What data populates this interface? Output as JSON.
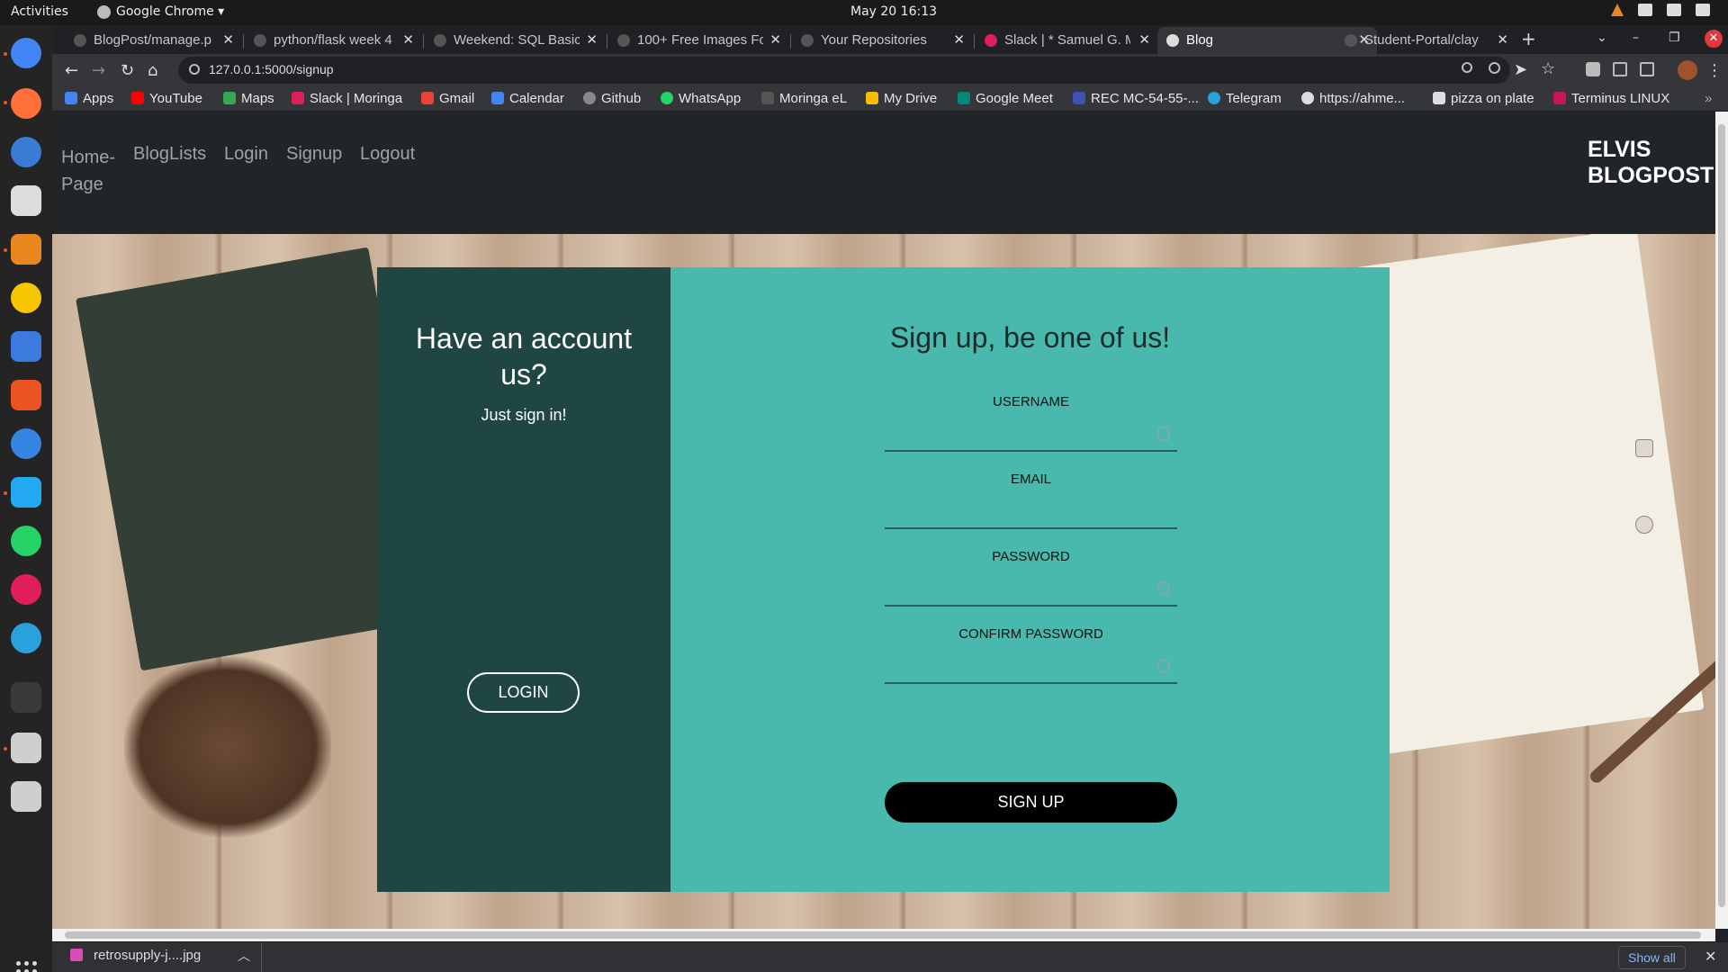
{
  "system": {
    "activities": "Activities",
    "app_name": "Google Chrome ▾",
    "clock": "May 20  16:13"
  },
  "tabs": [
    {
      "title": "BlogPost/manage.p",
      "active": false
    },
    {
      "title": "python/flask week 4",
      "active": false
    },
    {
      "title": "Weekend: SQL Basic",
      "active": false
    },
    {
      "title": "100+ Free Images Fo",
      "active": false
    },
    {
      "title": "Your Repositories",
      "active": false
    },
    {
      "title": "Slack | * Samuel G. M",
      "active": false
    },
    {
      "title": "Blog",
      "active": true
    },
    {
      "title": "Student-Portal/clay",
      "active": false
    }
  ],
  "address_bar": {
    "url": "127.0.0.1:5000/signup"
  },
  "bookmarks": [
    {
      "label": "Apps",
      "color": "#4285f4"
    },
    {
      "label": "YouTube",
      "color": "#ff0000"
    },
    {
      "label": "Maps",
      "color": "#34a853"
    },
    {
      "label": "Slack | Moringa",
      "color": "#e01e5a"
    },
    {
      "label": "Gmail",
      "color": "#ea4335"
    },
    {
      "label": "Calendar",
      "color": "#4285f4"
    },
    {
      "label": "Github",
      "color": "#888888"
    },
    {
      "label": "WhatsApp",
      "color": "#25d366"
    },
    {
      "label": "Moringa eL",
      "color": "#555555"
    },
    {
      "label": "My Drive",
      "color": "#fbbc04"
    },
    {
      "label": "Google Meet",
      "color": "#00897b"
    },
    {
      "label": "REC MC-54-55-...",
      "color": "#3f51b5"
    },
    {
      "label": "Telegram",
      "color": "#2aa1da"
    },
    {
      "label": "https://ahme...",
      "color": "#dddddd"
    },
    {
      "label": "pizza on plate",
      "color": "#dddddd"
    },
    {
      "label": "Terminus LINUX",
      "color": "#c2185b"
    }
  ],
  "site": {
    "nav": {
      "home_line1": "Home-",
      "home_line2": "Page",
      "bloglists": "BlogLists",
      "login": "Login",
      "signup": "Signup",
      "logout": "Logout"
    },
    "brand_line1": "ELVIS",
    "brand_line2": "BLOGPOST"
  },
  "signin_panel": {
    "heading": "Have an account us?",
    "subtext": "Just sign in!",
    "button": "LOGIN"
  },
  "signup_form": {
    "heading": "Sign up, be one of us!",
    "fields": [
      {
        "label": "USERNAME",
        "value": ""
      },
      {
        "label": "EMAIL",
        "value": ""
      },
      {
        "label": "PASSWORD",
        "value": ""
      },
      {
        "label": "CONFIRM PASSWORD",
        "value": ""
      }
    ],
    "submit": "SIGN UP"
  },
  "downloads": {
    "file": "retrosupply-j....jpg",
    "show_all": "Show all"
  },
  "colors": {
    "navbar": "#212529",
    "left_panel": "#1f4642",
    "right_panel": "#48b9ac",
    "signup_button": "#000000"
  }
}
